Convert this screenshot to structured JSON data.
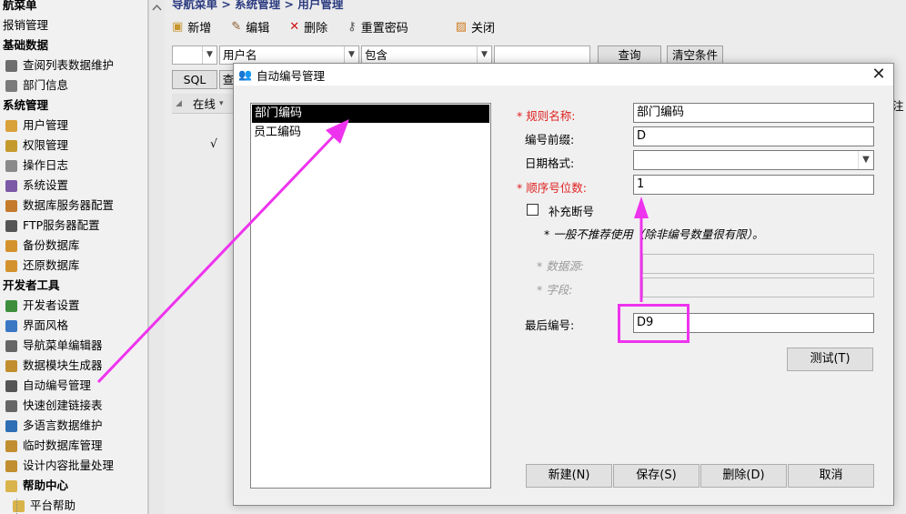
{
  "sidebar": {
    "top_items": [
      {
        "label": "航菜单",
        "kind": "group"
      },
      {
        "label": "报销管理",
        "kind": "group-light"
      },
      {
        "label": "基础数据",
        "kind": "group"
      },
      {
        "label": "查阅列表数据维护",
        "kind": "item",
        "icon": "table-icon",
        "color": "#6d6d6d"
      },
      {
        "label": "部门信息",
        "kind": "item",
        "icon": "document-icon",
        "color": "#7a7a7a"
      },
      {
        "label": "系统管理",
        "kind": "group"
      },
      {
        "label": "用户管理",
        "kind": "item",
        "icon": "users-icon",
        "color": "#d9a13a"
      },
      {
        "label": "权限管理",
        "kind": "item",
        "icon": "lock-icon",
        "color": "#c59a2c"
      },
      {
        "label": "操作日志",
        "kind": "item",
        "icon": "log-icon",
        "color": "#8a8a8a"
      },
      {
        "label": "系统设置",
        "kind": "item",
        "icon": "settings-icon",
        "color": "#7b5aa6"
      },
      {
        "label": "数据库服务器配置",
        "kind": "item",
        "icon": "database-icon",
        "color": "#c47b2b"
      },
      {
        "label": "FTP服务器配置",
        "kind": "item",
        "icon": "ftp-icon",
        "color": "#555"
      },
      {
        "label": "备份数据库",
        "kind": "item",
        "icon": "backup-icon",
        "color": "#d4922e"
      },
      {
        "label": "还原数据库",
        "kind": "item",
        "icon": "restore-icon",
        "color": "#d4922e"
      },
      {
        "label": "开发者工具",
        "kind": "group"
      },
      {
        "label": "开发者设置",
        "kind": "item",
        "icon": "developer-icon",
        "color": "#3e8e3e"
      },
      {
        "label": "界面风格",
        "kind": "item",
        "icon": "palette-icon",
        "color": "#3a78c4"
      },
      {
        "label": "导航菜单编辑器",
        "kind": "item",
        "icon": "menu-editor-icon",
        "color": "#666"
      },
      {
        "label": "数据模块生成器",
        "kind": "item",
        "icon": "generator-icon",
        "color": "#c18f2f"
      },
      {
        "label": "自动编号管理",
        "kind": "item",
        "icon": "numbering-icon",
        "color": "#555"
      },
      {
        "label": "快速创建链接表",
        "kind": "item",
        "icon": "link-icon",
        "color": "#666"
      },
      {
        "label": "多语言数据维护",
        "kind": "item",
        "icon": "language-icon",
        "color": "#2f6fb3"
      },
      {
        "label": "临时数据库管理",
        "kind": "item",
        "icon": "temp-db-icon",
        "color": "#c18f2f"
      },
      {
        "label": "设计内容批量处理",
        "kind": "item",
        "icon": "batch-icon",
        "color": "#c18f2f"
      },
      {
        "label": "帮助中心",
        "kind": "group-folder",
        "icon": "folder-icon",
        "color": "#d9b44a"
      },
      {
        "label": "平台帮助",
        "kind": "sub",
        "icon": "help-icon",
        "color": "#d9b44a"
      }
    ]
  },
  "main": {
    "breadcrumb": "导航菜单 > 系统管理 > 用户管理",
    "toolbar": {
      "new": "新增",
      "edit": "编辑",
      "delete": "删除",
      "reset_password": "重置密码",
      "close": "关闭"
    },
    "filter": {
      "field": "用户名",
      "operator": "包含",
      "query_button": "查询",
      "clear_button": "清空条件"
    },
    "sql_button": "SQL",
    "sql_next": "查",
    "grid": {
      "online_header": "在线",
      "check_mark": "√",
      "right_header": "注"
    }
  },
  "dialog": {
    "title": "自动编号管理",
    "close_glyph": "✕",
    "rules": [
      "部门编码",
      "员工编码"
    ],
    "selected_rule": 0,
    "labels": {
      "rule_name": "* 规则名称:",
      "prefix": "编号前缀:",
      "date_format": "日期格式:",
      "seq_digits": "* 顺序号位数:",
      "fill_gap": "补充断号",
      "note": "* 一般不推荐使用（除非编号数量很有限）。",
      "datasource": "* 数据源:",
      "field": "* 字段:",
      "last_number": "最后编号:"
    },
    "values": {
      "rule_name": "部门编码",
      "prefix": "D",
      "date_format": "",
      "seq_digits": "1",
      "datasource": "",
      "field": "",
      "last_number": "D9"
    },
    "fill_gap_checked": false,
    "buttons": {
      "test": "测试(T)",
      "new": "新建(N)",
      "save": "保存(S)",
      "delete": "删除(D)",
      "cancel": "取消"
    }
  },
  "annotation": {
    "color": "#ee33ee"
  }
}
